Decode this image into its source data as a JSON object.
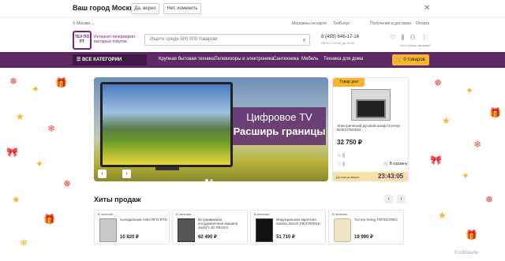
{
  "city_prompt": {
    "question": "Ваш город Москва?",
    "yes_label": "Да, верно",
    "no_label": "Нет, изменить"
  },
  "top_links": {
    "city": "Москва",
    "shops": "Магазины на карте",
    "techbonus": "ТехБонус",
    "delivery": "Получение и доставка",
    "pay": "Оплата"
  },
  "header": {
    "logo": "ТЕХ ПО РТ",
    "logo_sub": "Интернет-гипермаркет выгодных покупок",
    "search_placeholder": "Ищите среди 500 000 товаров!",
    "phone": "8 (495) 646-17-16",
    "phone_sub": "Пн-Пт с 09:00 до 19:00",
    "user_sub": "Что с моим заказом?"
  },
  "nav": {
    "catalog": "ВСЕ КАТЕГОРИИ",
    "items": [
      "Крупная бытовая техника",
      "Телевизоры и электроника",
      "Сантехника",
      "Мебель",
      "Техника для дома"
    ],
    "cart": "0 товаров"
  },
  "slider": {
    "title1": "Цифровое TV",
    "title2": "Расширь границы"
  },
  "product_of_day": {
    "badge": "Товар дня",
    "name": "Электрический духовой шкаф Gorenje BO6727E03NX",
    "price": "32 750 ₽",
    "avail": "В корзину",
    "timer_label": "До конца акции:",
    "timer": "23:43:05"
  },
  "hits": {
    "title": "Хиты продаж",
    "items": [
      {
        "stock": "В наличии",
        "name": "Холодильник Asko RFG RTD",
        "price": "10 820 ₽"
      },
      {
        "stock": "В наличии",
        "name": "Встраиваемая посудомоечная машина Jacky's JD FB4101",
        "price": "62 490 ₽"
      },
      {
        "stock": "В наличии",
        "name": "Индукционная варочная панель Bosch PIE375FB1E",
        "price": "51 710 ₽"
      },
      {
        "stock": "В наличии",
        "name": "Тостер Smeg TSF01CREU",
        "price": "19 990 ₽"
      }
    ]
  },
  "watermark": "EcoMatarie"
}
